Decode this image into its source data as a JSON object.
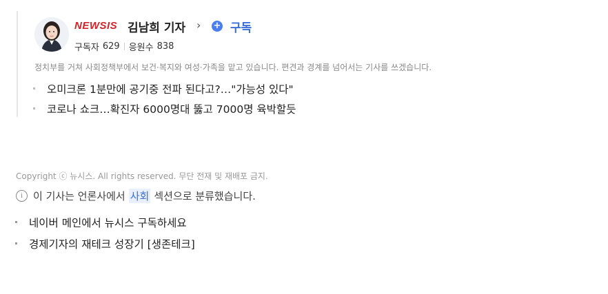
{
  "reporter": {
    "press_name": "NEWSIS",
    "name": "김남희 기자",
    "subscribe_label": "구독",
    "subscribers_label": "구독자",
    "subscribers_count": "629",
    "cheers_label": "응원수",
    "cheers_count": "838",
    "bio": "정치부를 거쳐 사회정책부에서 보건·복지와 여성·가족을 맡고 있습니다. 편견과 경계를 넘어서는 기사를 쓰겠습니다.",
    "articles": [
      "오미크론 1분만에 공기중 전파 된다고?…\"가능성 있다\"",
      "코로나 쇼크…확진자 6000명대 뚫고 7000명 육박할듯"
    ]
  },
  "footer": {
    "copyright": "Copyright ⓒ 뉴시스. All rights reserved. 무단 전재 및 재배포 금지.",
    "category_prefix": "이 기사는 언론사에서",
    "category_section": "사회",
    "category_suffix": "섹션으로 분류했습니다.",
    "promos": [
      "네이버 메인에서 뉴시스 구독하세요",
      "경제기자의 재테크 성장기 [생존테크]"
    ]
  },
  "colors": {
    "press_brand": "#d2232a",
    "subscribe_blue": "#3b6fdb",
    "muted_text": "#888888"
  }
}
